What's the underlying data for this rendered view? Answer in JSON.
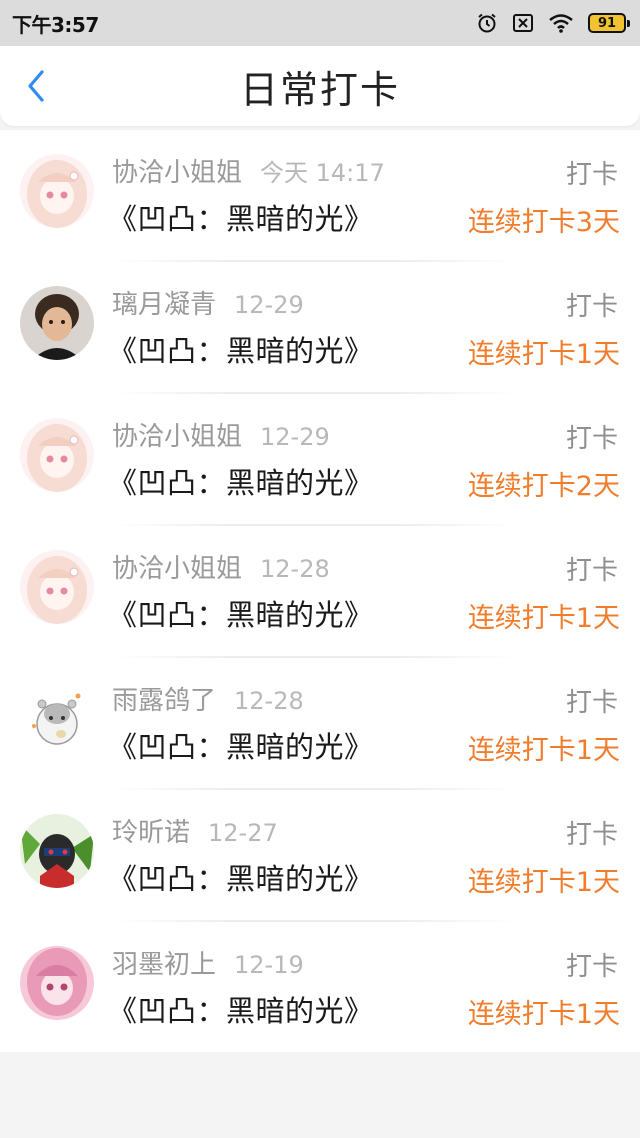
{
  "status_bar": {
    "time": "下午3:57",
    "battery": "91"
  },
  "header": {
    "title": "日常打卡"
  },
  "colors": {
    "accent_orange": "#f07d2c",
    "back_blue": "#2e8bf0"
  },
  "entries": [
    {
      "username": "协洽小姐姐",
      "time": "今天 14:17",
      "book": "《凹凸：黑暗的光》",
      "action": "打卡",
      "streak": "连续打卡3天",
      "avatar": "anime-girl-pink-avatar"
    },
    {
      "username": "璃月凝青",
      "time": "12-29",
      "book": "《凹凸：黑暗的光》",
      "action": "打卡",
      "streak": "连续打卡1天",
      "avatar": "child-photo-avatar"
    },
    {
      "username": "协洽小姐姐",
      "time": "12-29",
      "book": "《凹凸：黑暗的光》",
      "action": "打卡",
      "streak": "连续打卡2天",
      "avatar": "anime-girl-pink-avatar"
    },
    {
      "username": "协洽小姐姐",
      "time": "12-28",
      "book": "《凹凸：黑暗的光》",
      "action": "打卡",
      "streak": "连续打卡1天",
      "avatar": "anime-girl-pink-avatar"
    },
    {
      "username": "雨露鸽了",
      "time": "12-28",
      "book": "《凹凸：黑暗的光》",
      "action": "打卡",
      "streak": "连续打卡1天",
      "avatar": "hamster-cartoon-avatar"
    },
    {
      "username": "玲昕诺",
      "time": "12-27",
      "book": "《凹凸：黑暗的光》",
      "action": "打卡",
      "streak": "连续打卡1天",
      "avatar": "anime-character-green-avatar"
    },
    {
      "username": "羽墨初上",
      "time": "12-19",
      "book": "《凹凸：黑暗的光》",
      "action": "打卡",
      "streak": "连续打卡1天",
      "avatar": "anime-girl-pink-hair-avatar"
    }
  ]
}
